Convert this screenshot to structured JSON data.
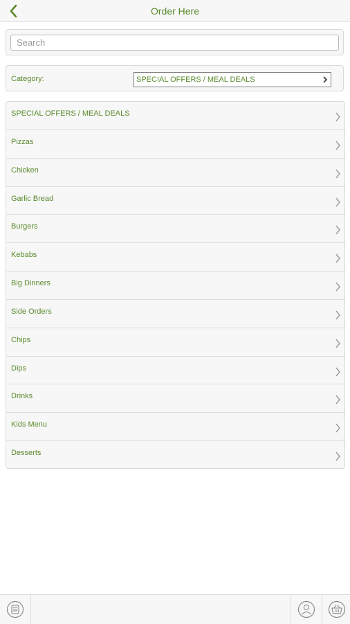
{
  "header": {
    "title": "Order Here",
    "back_icon": "chevron-left-icon"
  },
  "search": {
    "placeholder": "Search",
    "value": ""
  },
  "category": {
    "label": "Category:",
    "selected": "SPECIAL OFFERS / MEAL DEALS"
  },
  "menu": {
    "items": [
      {
        "label": "SPECIAL OFFERS / MEAL DEALS"
      },
      {
        "label": "Pizzas"
      },
      {
        "label": "Chicken"
      },
      {
        "label": "Garlic Bread"
      },
      {
        "label": "Burgers"
      },
      {
        "label": "Kebabs"
      },
      {
        "label": "Big Dinners"
      },
      {
        "label": "Side Orders"
      },
      {
        "label": "Chips"
      },
      {
        "label": "Dips"
      },
      {
        "label": "Drinks"
      },
      {
        "label": "Kids Menu"
      },
      {
        "label": "Desserts"
      }
    ]
  },
  "footer": {
    "icons": [
      "menu-list-icon",
      "user-icon",
      "basket-icon"
    ]
  },
  "colors": {
    "accent": "#5a8a2c",
    "chevron": "#9a9a9a",
    "background": "#f7f7f7"
  }
}
